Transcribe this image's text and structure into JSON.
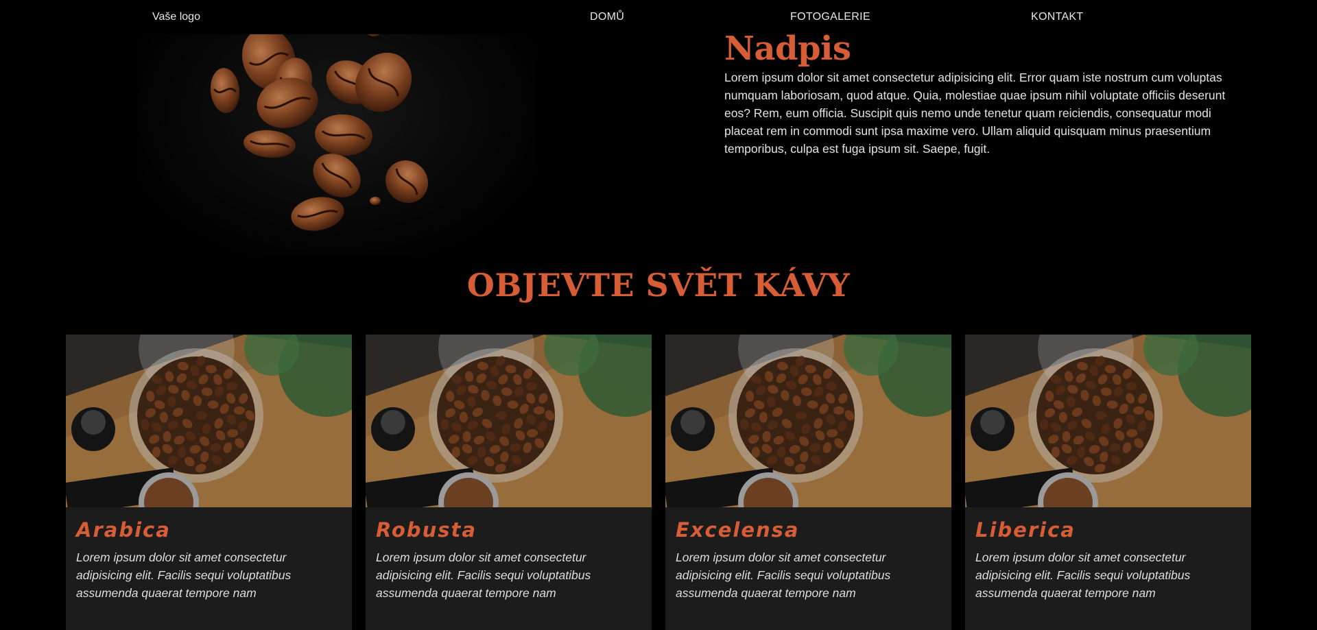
{
  "nav": {
    "logo": "Vaše logo",
    "links": [
      "DOMŮ",
      "FOTOGALERIE",
      "KONTAKT"
    ]
  },
  "hero": {
    "title": "Nadpis",
    "body": "Lorem ipsum dolor sit amet consectetur adipisicing elit. Error quam iste nostrum cum voluptas numquam laboriosam, quod atque. Quia, molestiae quae ipsum nihil voluptate officiis deserunt eos? Rem, eum officia. Suscipit quis nemo unde tenetur quam reiciendis, consequatur modi placeat rem in commodi sunt ipsa maxime vero. Ullam aliquid quisquam minus praesentium temporibus, culpa est fuga ipsum sit. Saepe, fugit."
  },
  "section": {
    "title": "OBJEVTE SVĚT KÁVY"
  },
  "cards": [
    {
      "title": "Arabica",
      "text": "Lorem ipsum dolor sit amet consectetur adipisicing elit. Facilis sequi voluptatibus assumenda quaerat tempore nam"
    },
    {
      "title": "Robusta",
      "text": "Lorem ipsum dolor sit amet consectetur adipisicing elit. Facilis sequi voluptatibus assumenda quaerat tempore nam"
    },
    {
      "title": "Excelensa",
      "text": "Lorem ipsum dolor sit amet consectetur adipisicing elit. Facilis sequi voluptatibus assumenda quaerat tempore nam"
    },
    {
      "title": "Liberica",
      "text": "Lorem ipsum dolor sit amet consectetur adipisicing elit. Facilis sequi voluptatibus assumenda quaerat tempore nam"
    }
  ],
  "colors": {
    "accent": "#d75d36",
    "background": "#000000",
    "card_background": "#1c1c1c",
    "text": "#e3e3e3"
  }
}
